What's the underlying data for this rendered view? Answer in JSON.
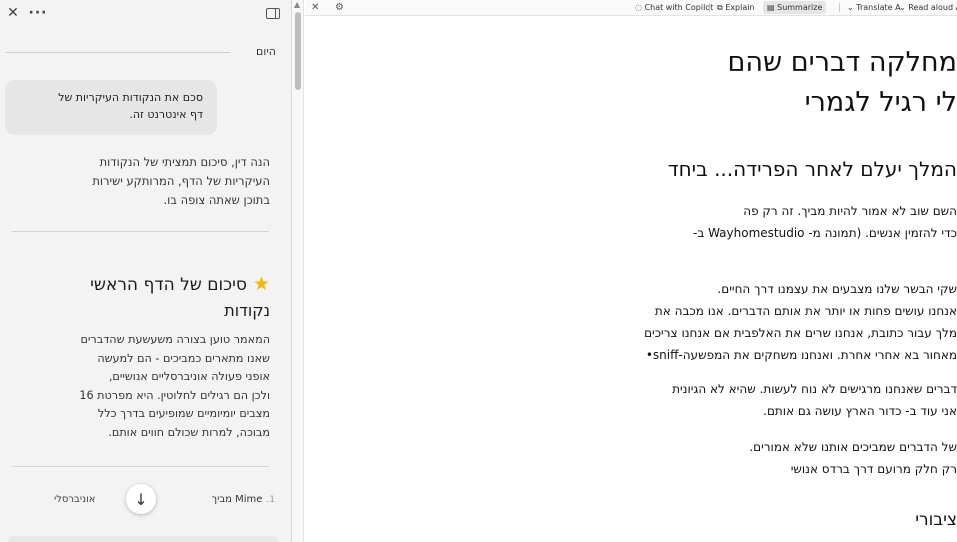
{
  "sidebar": {
    "close_icon": "close-icon",
    "more_icon": "more-icon",
    "split_icon": "split-view-icon",
    "day_label": "היום",
    "user_message_lines": [
      "סכם את הנקודות העיקריות של",
      "דף אינטרנט זה."
    ],
    "reply_lines": [
      "הנה דין, סיכום תמציתי של הנקודות",
      "העיקריות של הדף, המרותקע ישירות",
      "בתוכן שאתה צופה בו."
    ],
    "summary_heading": "סיכום של הדף הראשי",
    "summary_subheading": "נקודות",
    "summary_lines": [
      "המאמר טוען בצורה משעשעת שהדברים",
      "שאנו מתארים כמביכים - הם למעשה",
      "אופני פעולה אוניברסליים אנושיים,",
      "ולכן הם רגילים לחלוטין. היא מפרטת 16",
      "מצבים יומיומיים שמופיעים בדרך כלל",
      "מבוכה, למרות שכולם חווים אותם."
    ],
    "citation_number": "1.",
    "citation_text": "Mime מביך",
    "citation_left": "אוניברסלי",
    "scroll_down_icon": "arrow-down-icon"
  },
  "toolbar": {
    "close": "✕",
    "chat": "Chat with Copilot",
    "explain": "Explain",
    "summarize": "Summarize",
    "translate": "Translate",
    "read_aloud": "Read aloud"
  },
  "article": {
    "title_line1": "מחלקה דברים שהם",
    "title_line2": "לי רגיל לגמרי",
    "section_title": "המלך יעלם לאחר הפרידה... ביחד",
    "p1_lines": [
      "השם שוב לא אמור להיות מביך. זה רק פה",
      "כדי להזמין אנשים. (תמונה מ- Wayhomestudio ב-"
    ],
    "p2_lines": [
      "שקי הבשר שלנו מצבעים את עצמנו דרך החיים.",
      "אנחנו עושים פחות או יותר את אותם הדברים. אנו מכבה את",
      "מלך עבור כתובת, אנחנו שרים את האלפבית אם אנחנו צריכים",
      "מאחור בא אחרי אחרת. ואנחנו משחקים את המפשעה-sniff•"
    ],
    "p3_lines": [
      "דברים שאנחנו מרגישים לא נוח לעשות. שהיא לא הגיונית",
      "אני עוד ב-     כדור הארץ עושה גם אותם."
    ],
    "p4_lines": [
      "של הדברים שמביכים אותנו שלא אמורים.",
      "רק חלק מרועם דרך ברדס אנושי"
    ],
    "bottom_title": "ציבורי"
  }
}
